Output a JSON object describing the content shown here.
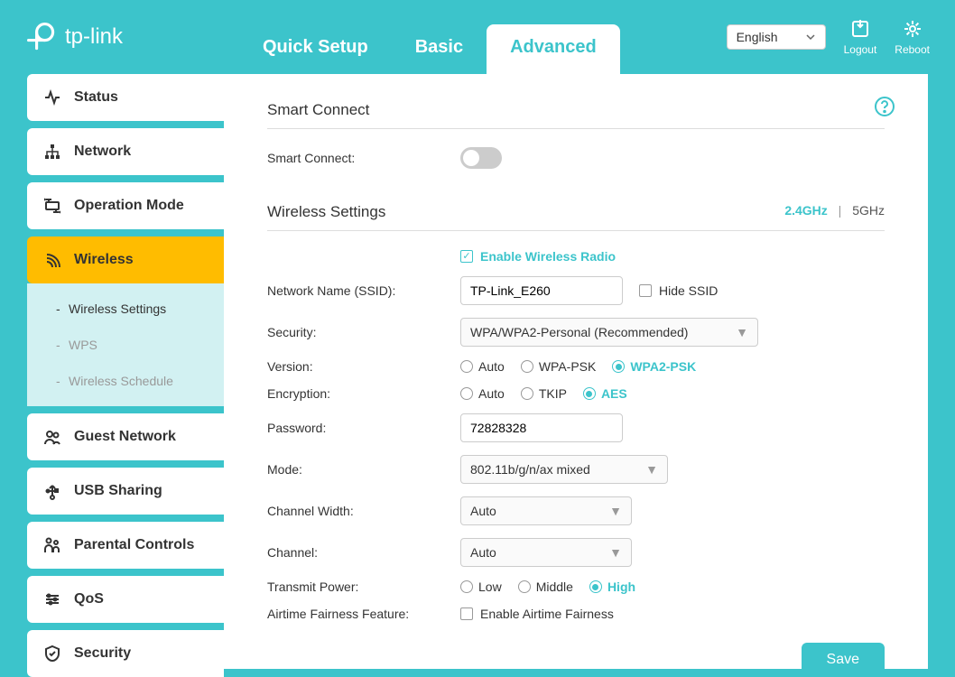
{
  "brand": "tp-link",
  "header": {
    "tabs": {
      "quick_setup": "Quick Setup",
      "basic": "Basic",
      "advanced": "Advanced"
    },
    "language": "English",
    "logout": "Logout",
    "reboot": "Reboot"
  },
  "sidebar": {
    "status": "Status",
    "network": "Network",
    "operation_mode": "Operation Mode",
    "wireless": "Wireless",
    "wireless_sub": {
      "settings": "Wireless Settings",
      "wps": "WPS",
      "schedule": "Wireless Schedule"
    },
    "guest_network": "Guest Network",
    "usb_sharing": "USB Sharing",
    "parental_controls": "Parental Controls",
    "qos": "QoS",
    "security": "Security"
  },
  "content": {
    "smart_connect_title": "Smart Connect",
    "smart_connect_label": "Smart Connect:",
    "wireless_settings_title": "Wireless Settings",
    "band_24": "2.4GHz",
    "band_5": "5GHz",
    "enable_radio": "Enable Wireless Radio",
    "ssid_label": "Network Name (SSID):",
    "ssid_value": "TP-Link_E260",
    "hide_ssid": "Hide SSID",
    "security_label": "Security:",
    "security_value": "WPA/WPA2-Personal (Recommended)",
    "version_label": "Version:",
    "version_options": {
      "auto": "Auto",
      "wpa": "WPA-PSK",
      "wpa2": "WPA2-PSK"
    },
    "encryption_label": "Encryption:",
    "encryption_options": {
      "auto": "Auto",
      "tkip": "TKIP",
      "aes": "AES"
    },
    "password_label": "Password:",
    "password_value": "72828328",
    "mode_label": "Mode:",
    "mode_value": "802.11b/g/n/ax mixed",
    "channel_width_label": "Channel Width:",
    "channel_width_value": "Auto",
    "channel_label": "Channel:",
    "channel_value": "Auto",
    "transmit_power_label": "Transmit Power:",
    "transmit_options": {
      "low": "Low",
      "middle": "Middle",
      "high": "High"
    },
    "airtime_label": "Airtime Fairness Feature:",
    "airtime_check": "Enable Airtime Fairness",
    "save": "Save"
  }
}
